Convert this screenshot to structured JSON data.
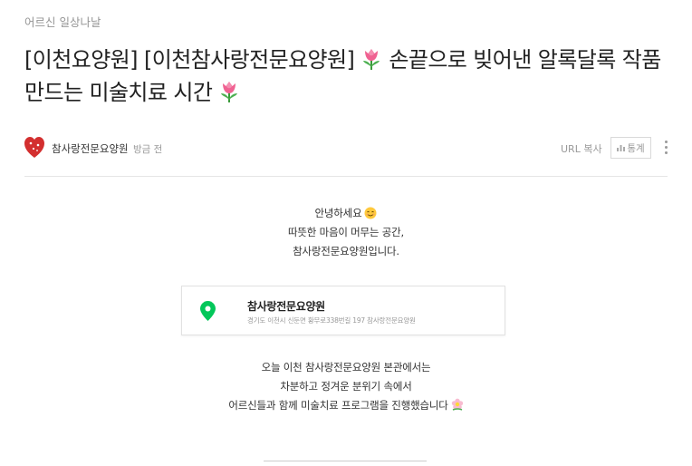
{
  "post": {
    "category": "어르신 일상나날",
    "title_prefix": "[이천요양원] [이천참사랑전문요양원]",
    "title_middle": "손끝으로 빚어낸 알록달록 작품 만드는 미술치료 시간",
    "icons": {
      "title_emoji": "tulip-icon",
      "smile_emoji": "smiling-face-icon",
      "flower_emoji": "blossom-icon",
      "map_pin": "map-pin-icon",
      "stats": "bar-chart-icon",
      "more": "more-vertical-icon"
    }
  },
  "author": {
    "name": "참사랑전문요양원",
    "time": "방금 전"
  },
  "actions": {
    "url_copy": "URL 복사",
    "stats": "통계"
  },
  "body": {
    "intro": [
      "안녕하세요",
      "따뜻한 마음이 머무는 공간,",
      "참사랑전문요양원입니다."
    ],
    "paragraph": [
      "오늘 이천 참사랑전문요양원 본관에서는",
      "차분하고 정겨운 분위기 속에서",
      "어르신들과 함께 미술치료 프로그램을 진행했습니다"
    ]
  },
  "place": {
    "name": "참사랑전문요양원",
    "address": "경기도 이천시 신둔면 황무로338번길 197 참사랑전문요양원"
  },
  "colors": {
    "pin_green": "#03c75a",
    "title_text": "#222222",
    "muted_text": "#999999"
  }
}
